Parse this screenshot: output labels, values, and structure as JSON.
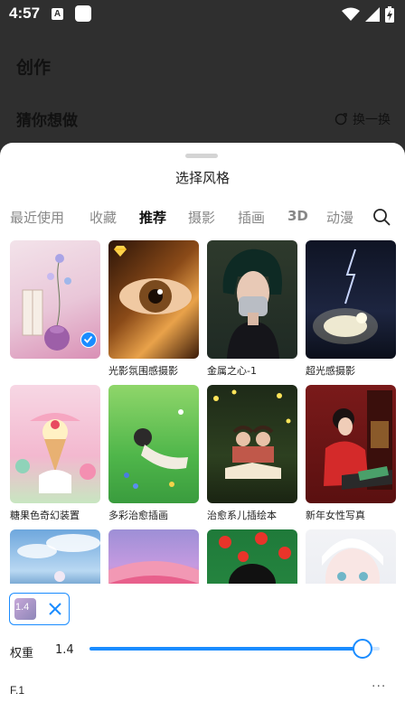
{
  "status_bar": {
    "time": "4:57",
    "notif_a": "A",
    "icons": [
      "wifi-icon",
      "signal-icon",
      "battery-charging-icon"
    ]
  },
  "background": {
    "title": "创作",
    "section": "猜你想做",
    "refresh_label": "换一换"
  },
  "sheet": {
    "title": "选择风格",
    "tabs": [
      {
        "label": "最近使用"
      },
      {
        "label": "收藏"
      },
      {
        "label": "推荐",
        "active": true
      },
      {
        "label": "摄影"
      },
      {
        "label": "插画"
      },
      {
        "label": "3D"
      },
      {
        "label": "动漫"
      }
    ],
    "styles": [
      {
        "name": "",
        "selected": true
      },
      {
        "name": "光影氛围感摄影",
        "premium": true
      },
      {
        "name": "金属之心-1"
      },
      {
        "name": "超光感摄影"
      },
      {
        "name": "糖果色奇幻装置"
      },
      {
        "name": "多彩治愈插画"
      },
      {
        "name": "治愈系儿插绘本"
      },
      {
        "name": "新年女性写真"
      },
      {
        "name": ""
      },
      {
        "name": ""
      },
      {
        "name": ""
      },
      {
        "name": ""
      }
    ]
  },
  "bottom": {
    "chip_value": "1.4",
    "weight_label": "权重",
    "weight_value": "1.4",
    "weight_fraction": 0.94,
    "version": "F.1",
    "more_label": "···"
  },
  "colors": {
    "accent": "#1a8cff",
    "overlay_bg": "#2f2f2f"
  }
}
